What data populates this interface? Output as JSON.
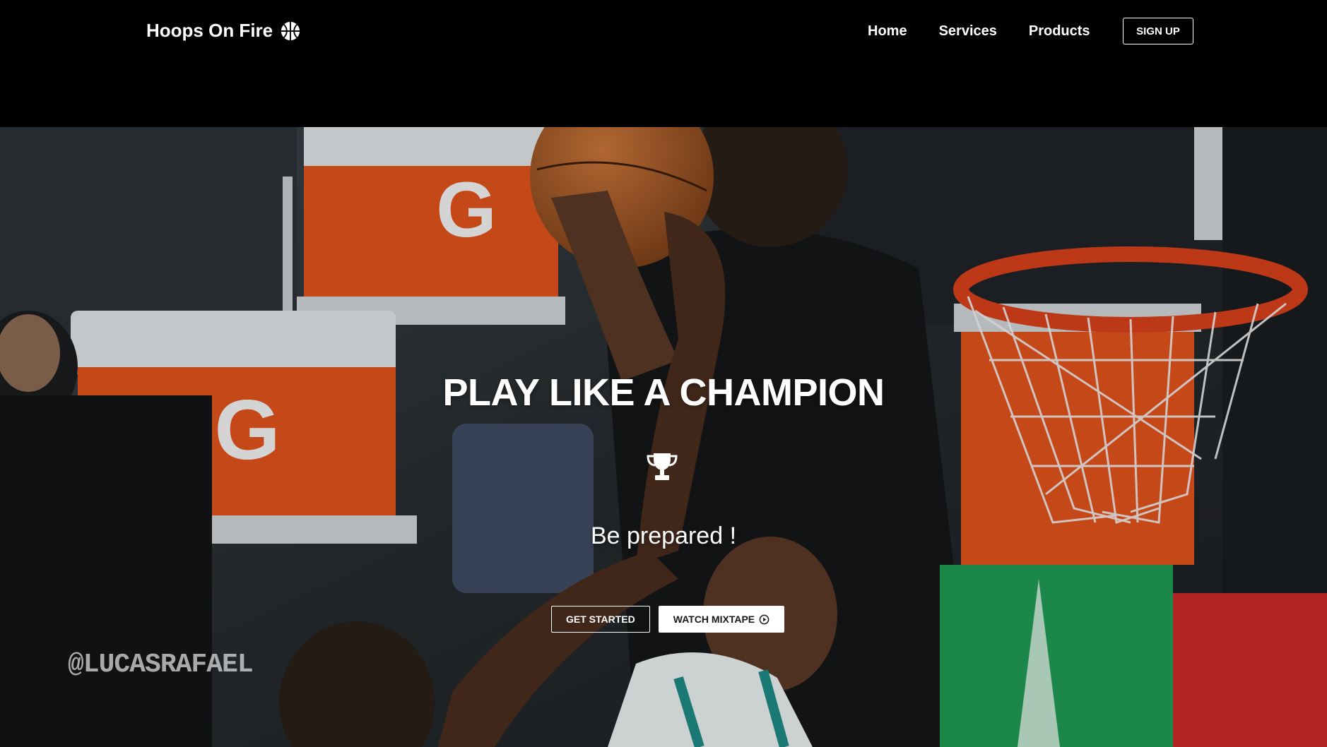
{
  "brand": {
    "name": "Hoops On Fire",
    "icon": "basketball-icon"
  },
  "nav": {
    "links": [
      "Home",
      "Services",
      "Products"
    ],
    "signup_label": "SIGN UP"
  },
  "hero": {
    "title": "PLAY LIKE A CHAMPION",
    "icon": "trophy-icon",
    "subtitle": "Be prepared !",
    "primary_button": "GET STARTED",
    "secondary_button": "WATCH MIXTAPE",
    "secondary_button_icon": "play-circle-icon",
    "watermark": "@LUCASRAFAEL"
  },
  "colors": {
    "navbar_bg": "#000000",
    "text": "#ffffff",
    "accent_orange": "#e0521c",
    "rim_orange": "#d8401a"
  }
}
